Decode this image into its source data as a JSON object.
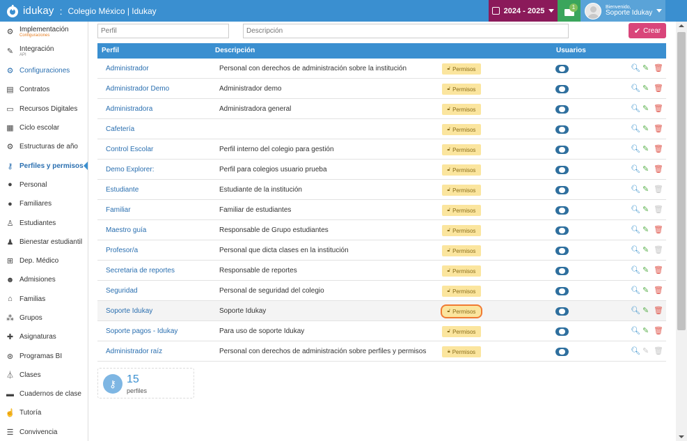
{
  "header": {
    "brand": "idukay",
    "separator": ":",
    "title": "Colegio México | Idukay",
    "year": "2024 - 2025",
    "mail_badge": "1",
    "user_greeting": "Bienvenido,",
    "user_name": "Soporte Idukay"
  },
  "sidebar": {
    "items": [
      {
        "label": "Implementación",
        "sub": "Configuraciones",
        "icon": "gears-icon"
      },
      {
        "label": "Integración",
        "sub": "API",
        "icon": "plug-icon"
      },
      {
        "label": "Configuraciones",
        "icon": "gears-icon"
      },
      {
        "label": "Contratos",
        "icon": "document-icon"
      },
      {
        "label": "Recursos Digitales",
        "icon": "laptop-icon"
      },
      {
        "label": "Ciclo escolar",
        "icon": "calendar-icon"
      },
      {
        "label": "Estructuras de año",
        "icon": "gear-icon"
      },
      {
        "label": "Perfiles y permisos",
        "icon": "key-icon"
      },
      {
        "label": "Personal",
        "icon": "person-icon"
      },
      {
        "label": "Familiares",
        "icon": "person-icon"
      },
      {
        "label": "Estudiantes",
        "icon": "child-icon"
      },
      {
        "label": "Bienestar estudiantil",
        "icon": "student-icon"
      },
      {
        "label": "Dep. Médico",
        "icon": "medkit-icon"
      },
      {
        "label": "Admisiones",
        "icon": "users-icon"
      },
      {
        "label": "Familias",
        "icon": "home-icon"
      },
      {
        "label": "Grupos",
        "icon": "sitemap-icon"
      },
      {
        "label": "Asignaturas",
        "icon": "puzzle-icon"
      },
      {
        "label": "Programas BI",
        "icon": "globe-icon"
      },
      {
        "label": "Clases",
        "icon": "flask-icon"
      },
      {
        "label": "Cuadernos de clase",
        "icon": "book-icon"
      },
      {
        "label": "Tutoría",
        "icon": "thumbs-up-icon"
      },
      {
        "label": "Convivencia",
        "icon": "list-icon"
      }
    ]
  },
  "filters": {
    "perfil_placeholder": "Perfil",
    "descripcion_placeholder": "Descripción",
    "crear_label": "Crear"
  },
  "table": {
    "headers": {
      "perfil": "Perfil",
      "descripcion": "Descripción",
      "usuarios": "Usuarios"
    },
    "permisos_label": "Permisos",
    "rows": [
      {
        "perfil": "Administrador",
        "descripcion": "Personal con derechos de administración sobre la institución",
        "deletable": true
      },
      {
        "perfil": "Administrador Demo",
        "descripcion": "Administrador demo",
        "deletable": true
      },
      {
        "perfil": "Administradora",
        "descripcion": "Administradora general",
        "deletable": true
      },
      {
        "perfil": "Cafetería",
        "descripcion": "",
        "deletable": true
      },
      {
        "perfil": "Control Escolar",
        "descripcion": "Perfil interno del colegio para gestión",
        "deletable": true
      },
      {
        "perfil": "Demo Explorer:",
        "descripcion": "Perfil para colegios usuario prueba",
        "deletable": true
      },
      {
        "perfil": "Estudiante",
        "descripcion": "Estudiante de la institución",
        "deletable": false
      },
      {
        "perfil": "Familiar",
        "descripcion": "Familiar de estudiantes",
        "deletable": false
      },
      {
        "perfil": "Maestro guía",
        "descripcion": "Responsable de Grupo estudiantes",
        "deletable": true
      },
      {
        "perfil": "Profesor/a",
        "descripcion": "Personal que dicta clases en la institución",
        "deletable": false
      },
      {
        "perfil": "Secretaria de reportes",
        "descripcion": "Responsable de reportes",
        "deletable": true
      },
      {
        "perfil": "Seguridad",
        "descripcion": "Personal de seguridad del colegio",
        "deletable": true
      },
      {
        "perfil": "Soporte Idukay",
        "descripcion": "Soporte Idukay",
        "deletable": true
      },
      {
        "perfil": "Soporte pagos - Idukay",
        "descripcion": "Para uso de soporte Idukay",
        "deletable": true
      },
      {
        "perfil": "Administrador raíz",
        "descripcion": "Personal con derechos de administración sobre perfiles y permisos",
        "deletable": false
      }
    ]
  },
  "summary": {
    "count": "15",
    "label": "perfiles"
  },
  "colors": {
    "primary": "#3a8fd0",
    "year": "#8b1a5a",
    "mail": "#3aa55c",
    "create": "#d9457a",
    "permisos": "#fbe59e"
  }
}
